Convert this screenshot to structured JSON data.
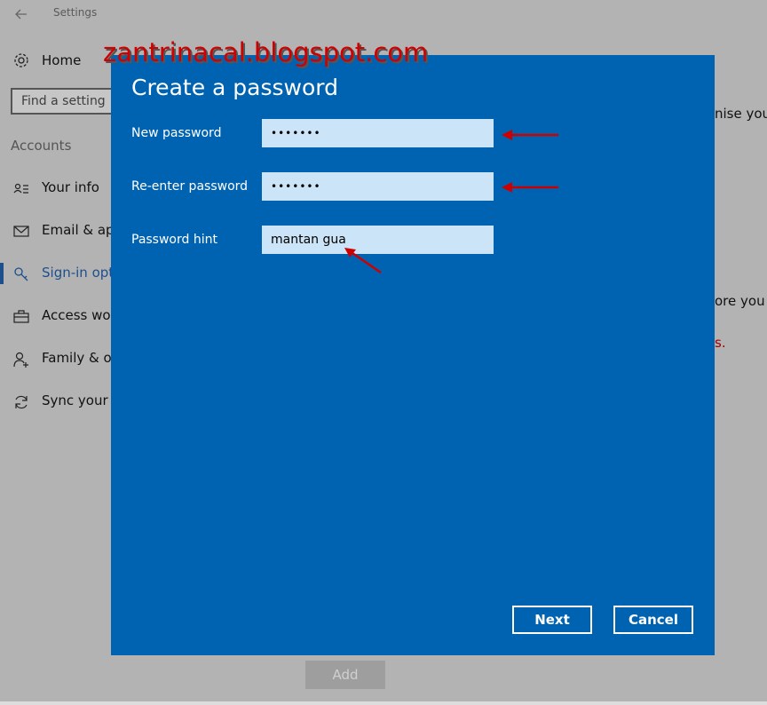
{
  "window": {
    "title": "Settings"
  },
  "sidebar": {
    "home_label": "Home",
    "search_placeholder": "Find a setting",
    "section_label": "Accounts",
    "items": [
      {
        "label": "Your info",
        "icon": "person-card-icon"
      },
      {
        "label": "Email & app",
        "icon": "mail-icon"
      },
      {
        "label": "Sign-in opti",
        "icon": "key-icon"
      },
      {
        "label": "Access work",
        "icon": "briefcase-icon"
      },
      {
        "label": "Family & oth",
        "icon": "person-add-icon"
      },
      {
        "label": "Sync your se",
        "icon": "sync-icon"
      }
    ]
  },
  "background": {
    "fragments": [
      "nise you.",
      "ore you ca",
      "s."
    ],
    "add_label": "Add"
  },
  "dialog": {
    "title": "Create a password",
    "fields": [
      {
        "label": "New password",
        "value": "•••••••"
      },
      {
        "label": "Re-enter password",
        "value": "•••••••"
      },
      {
        "label": "Password hint",
        "value": "mantan gua"
      }
    ],
    "next_label": "Next",
    "cancel_label": "Cancel"
  },
  "watermark": "zantrinacal.blogspot.com",
  "colors": {
    "dialog_bg": "#0063b1",
    "field_bg": "#cce4f7",
    "annotation_red": "#cc0000",
    "active_accent": "#1d4f8c"
  }
}
